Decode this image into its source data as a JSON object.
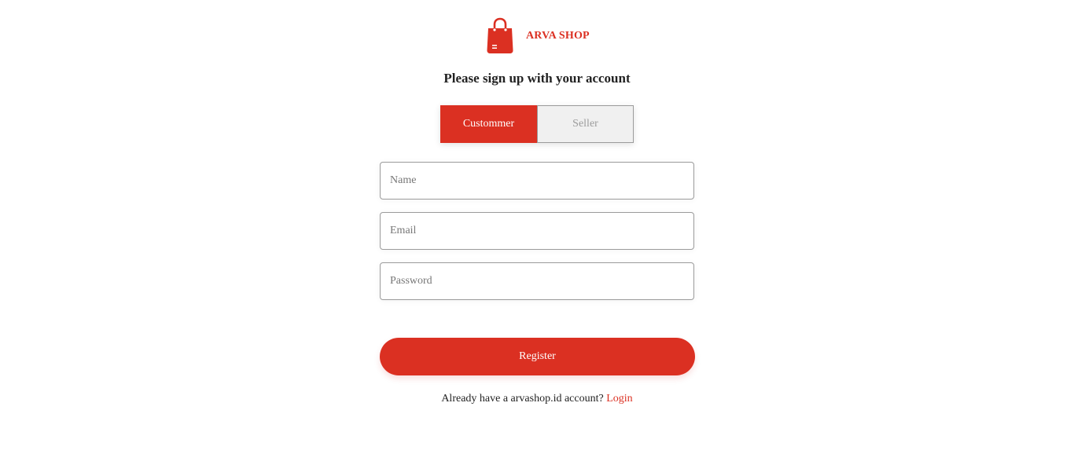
{
  "brand": {
    "name": "ARVA SHOP",
    "icon": "shopping-bag-icon",
    "color": "#db3022"
  },
  "heading": "Please sign up with your account",
  "role_toggle": {
    "options": [
      {
        "label": "Custommer",
        "active": true
      },
      {
        "label": "Seller",
        "active": false
      }
    ]
  },
  "form": {
    "name_placeholder": "Name",
    "email_placeholder": "Email",
    "password_placeholder": "Password",
    "register_label": "Register"
  },
  "footer": {
    "prompt": "Already have a arvashop.id account?",
    "login_label": "Login"
  },
  "colors": {
    "accent": "#db3022",
    "inactive_bg": "#f0f0f0",
    "inactive_text": "#9b9b9b"
  }
}
